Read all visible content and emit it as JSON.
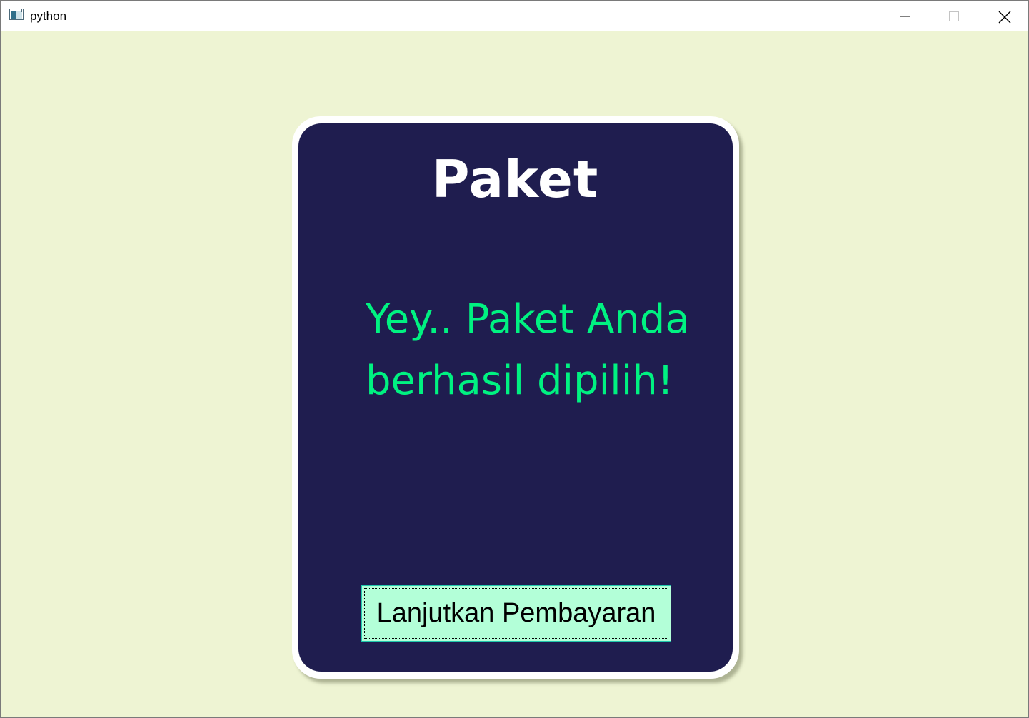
{
  "window": {
    "title": "python",
    "icon": "python-app-icon",
    "controls": {
      "minimize_icon": "minimize-icon",
      "maximize_icon": "maximize-icon",
      "close_icon": "close-icon"
    }
  },
  "card": {
    "title": "Paket",
    "message": "Yey.. Paket Anda berhasil dipilih!",
    "button_label": "Lanjutkan Pembayaran"
  },
  "colors": {
    "background": "#eef4d3",
    "card": "#1f1d4f",
    "title": "#ffffff",
    "message": "#00f281",
    "button": "#b3ffd8"
  }
}
